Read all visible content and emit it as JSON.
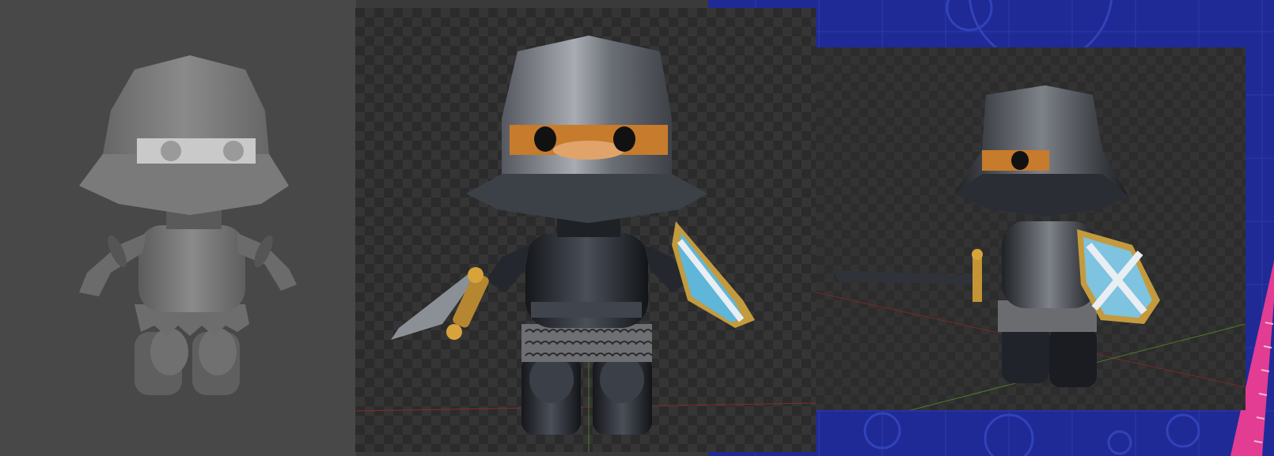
{
  "scene": {
    "panels": [
      {
        "name": "clay-render",
        "style": "untextured gray sculpt"
      },
      {
        "name": "textured-render-front",
        "style": "metal knight with sword and shield"
      },
      {
        "name": "textured-render-angled",
        "style": "metal knight with sword and shield, perspective view"
      }
    ],
    "background_accent": "#1f2a96",
    "ruler_color": "#e23c93"
  }
}
